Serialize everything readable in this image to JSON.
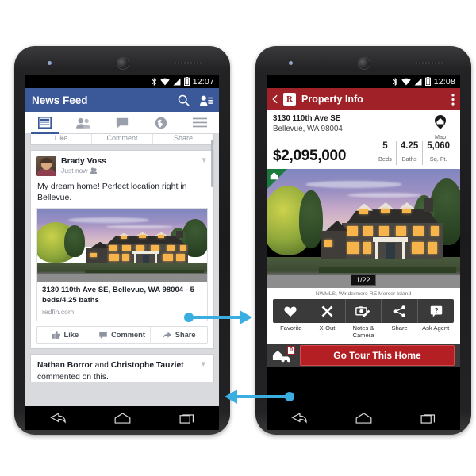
{
  "left_phone": {
    "name": "android-phone-facebook",
    "status_bar": {
      "clock": "12:07",
      "icons": [
        "bluetooth-icon",
        "wifi-icon",
        "signal-icon",
        "battery-icon"
      ]
    },
    "app": {
      "name": "facebook",
      "header": {
        "title": "News Feed",
        "search_icon": "search-icon",
        "requests_icon": "friend-requests-icon"
      },
      "tabs": [
        {
          "name": "news-feed",
          "icon": "news-feed-icon",
          "active": true
        },
        {
          "name": "friends",
          "icon": "friends-icon",
          "active": false
        },
        {
          "name": "messages",
          "icon": "messages-icon",
          "active": false
        },
        {
          "name": "notifications",
          "icon": "globe-icon",
          "active": false
        },
        {
          "name": "more",
          "icon": "hamburger-menu-icon",
          "active": false
        }
      ],
      "partial_post_actions": [
        "Like",
        "Comment",
        "Share"
      ],
      "post": {
        "author": "Brady Voss",
        "time": "Just now",
        "privacy_icon": "friends-privacy-icon",
        "text": "My dream home! Perfect location right in Bellevue.",
        "attachment": {
          "title": "3130 110th Ave SE, Bellevue, WA 98004 - 5 beds/4.25 baths",
          "domain": "redfin.com"
        },
        "actions": [
          {
            "label": "Like",
            "icon": "thumbs-up-icon"
          },
          {
            "label": "Comment",
            "icon": "comment-bubble-icon"
          },
          {
            "label": "Share",
            "icon": "share-arrow-icon"
          }
        ]
      },
      "next_post": {
        "names_1": "Nathan Borror",
        "conjunction": " and ",
        "names_2": "Christophe Tauziet",
        "subtitle": "commented on this."
      }
    },
    "nav_bar": [
      "back-icon",
      "home-icon",
      "recents-icon"
    ]
  },
  "right_phone": {
    "name": "android-phone-redfin",
    "status_bar": {
      "clock": "12:08",
      "icons": [
        "bluetooth-icon",
        "wifi-icon",
        "signal-icon",
        "battery-icon"
      ]
    },
    "app": {
      "name": "redfin",
      "header": {
        "back_icon": "back-chevron-icon",
        "logo": "R",
        "title": "Property Info",
        "overflow_icon": "overflow-menu-icon"
      },
      "address_line1": "3130 110th Ave SE",
      "address_line2": "Bellevue, WA 98004",
      "map_button": {
        "label": "Map",
        "icon": "map-pin-house-icon"
      },
      "price": "$2,095,000",
      "stats": [
        {
          "value": "5",
          "label": "Beds"
        },
        {
          "value": "4.25",
          "label": "Baths"
        },
        {
          "value": "5,060",
          "label": "Sq. Ft."
        }
      ],
      "photo": {
        "counter": "1/22",
        "corner_badge_icon": "house-icon"
      },
      "attribution": "NWMLS, Windermere RE Mercer Island",
      "actions": [
        {
          "label": "Favorite",
          "icon": "heart-icon"
        },
        {
          "label": "X-Out",
          "icon": "x-icon"
        },
        {
          "label": "Notes & Camera",
          "icon": "camera-note-icon"
        },
        {
          "label": "Share",
          "icon": "share-node-icon"
        },
        {
          "label": "Ask Agent",
          "icon": "question-bubble-icon"
        }
      ],
      "bottom_bar": {
        "tour_icon": "house-car-icon",
        "tour_badge": "0",
        "tour_button": "Go Tour This Home"
      }
    },
    "nav_bar": [
      "back-icon",
      "home-icon",
      "recents-icon"
    ]
  },
  "annotations": {
    "arrow_top": {
      "name": "arrow-to-property-info",
      "direction": "right"
    },
    "arrow_bottom": {
      "name": "arrow-back-to-news-feed",
      "direction": "left"
    }
  },
  "colors": {
    "facebook_blue": "#3b5999",
    "redfin_red": "#a02128",
    "arrow_blue": "#3aaee0",
    "green_badge": "#1b7a3e"
  }
}
